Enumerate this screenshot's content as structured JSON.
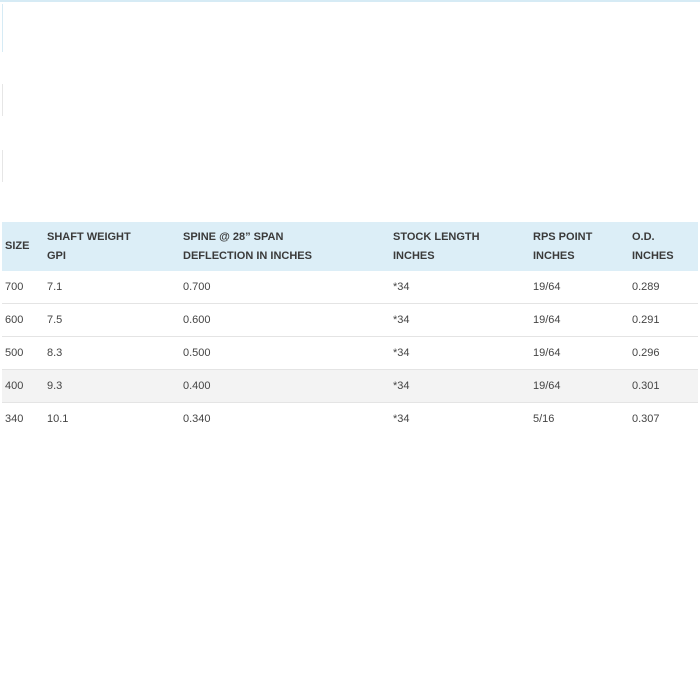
{
  "table": {
    "headers": [
      {
        "line1": "SIZE",
        "line2": ""
      },
      {
        "line1": "SHAFT WEIGHT",
        "line2": "GPI"
      },
      {
        "line1": "SPINE @ 28” SPAN",
        "line2": "DEFLECTION IN INCHES"
      },
      {
        "line1": "STOCK LENGTH",
        "line2": "INCHES"
      },
      {
        "line1": "RPS POINT",
        "line2": "INCHES"
      },
      {
        "line1": "O.D.",
        "line2": "INCHES"
      }
    ],
    "rows": [
      [
        "700",
        "7.1",
        "0.700",
        "*34",
        "19/64",
        "0.289"
      ],
      [
        "600",
        "7.5",
        "0.600",
        "*34",
        "19/64",
        "0.291"
      ],
      [
        "500",
        "8.3",
        "0.500",
        "*34",
        "19/64",
        "0.296"
      ],
      [
        "400",
        "9.3",
        "0.400",
        "*34",
        "19/64",
        "0.301"
      ],
      [
        "340",
        "10.1",
        "0.340",
        "*34",
        "5/16",
        "0.307"
      ]
    ]
  },
  "colors": {
    "header_bg": "#dceef7",
    "stripe_bg": "#f3f3f3",
    "row_border": "#e4e4e4"
  }
}
